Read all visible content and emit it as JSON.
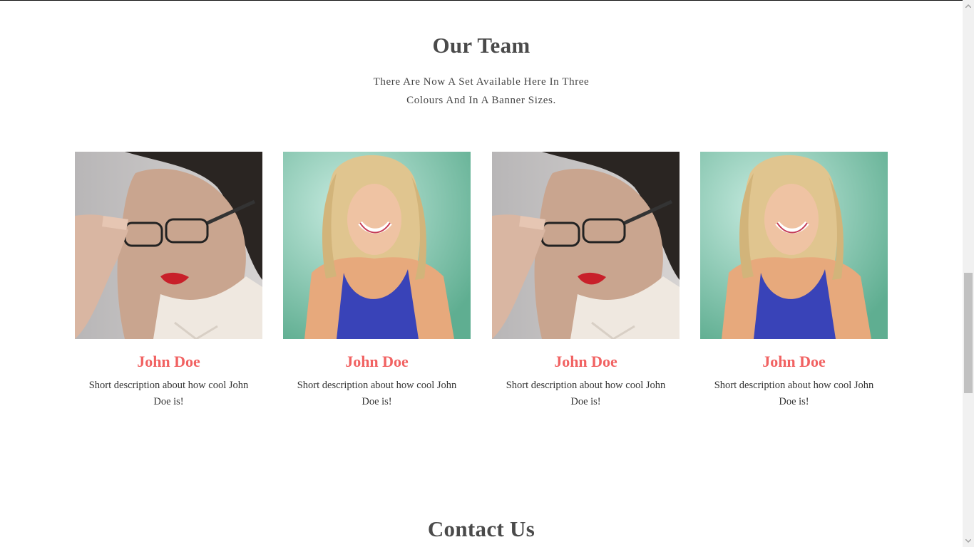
{
  "team": {
    "title": "Our Team",
    "intro": "There Are Now A Set Available Here In Three Colours And In A Banner Sizes.",
    "members": [
      {
        "name": "John Doe",
        "description": "Short description about how cool John Doe is!",
        "photo": "woman-glasses-photo"
      },
      {
        "name": "John Doe",
        "description": "Short description about how cool John Doe is!",
        "photo": "blonde-woman-photo"
      },
      {
        "name": "John Doe",
        "description": "Short description about how cool John Doe is!",
        "photo": "woman-glasses-photo"
      },
      {
        "name": "John Doe",
        "description": "Short description about how cool John Doe is!",
        "photo": "blonde-woman-photo"
      }
    ]
  },
  "contact": {
    "title": "Contact Us"
  },
  "colors": {
    "accent": "#f16262",
    "heading": "#4a4a4a",
    "text": "#444444"
  },
  "scrollbar": {
    "up_icon": "chevron-up-icon",
    "down_icon": "chevron-down-icon"
  }
}
